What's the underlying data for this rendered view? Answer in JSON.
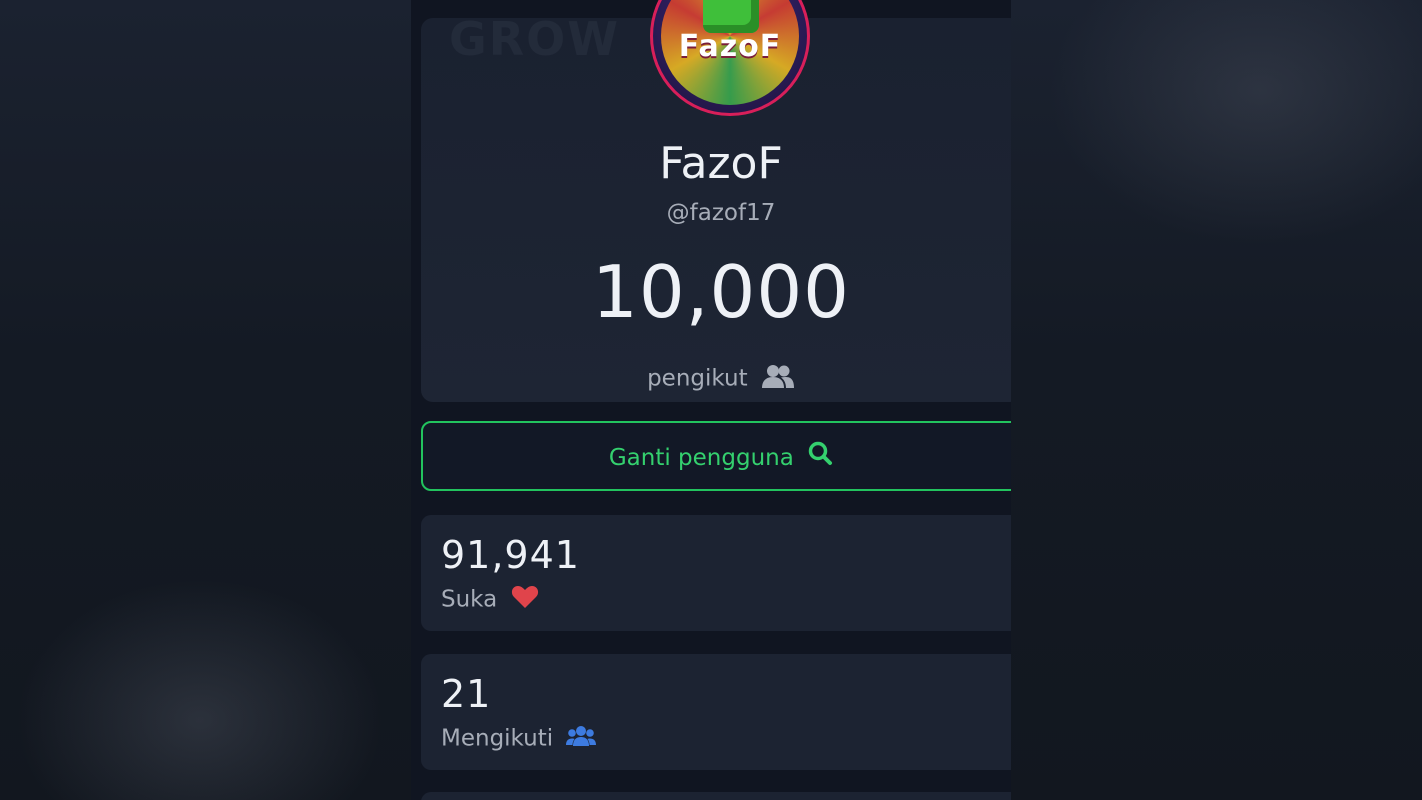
{
  "profile": {
    "avatar_text": "FazoF",
    "display_name": "FazoF",
    "handle": "@fazof17",
    "follower_count": "10,000",
    "follower_label": "pengikut",
    "follower_icon": "users-icon"
  },
  "switch_user": {
    "label": "Ganti pengguna",
    "icon": "search-icon",
    "color": "#22c35e"
  },
  "stats": [
    {
      "value": "91,941",
      "label": "Suka",
      "icon": "heart-icon",
      "icon_color": "#e0444b"
    },
    {
      "value": "21",
      "label": "Mengikuti",
      "icon": "users-icon",
      "icon_color": "#3d7be0"
    }
  ]
}
